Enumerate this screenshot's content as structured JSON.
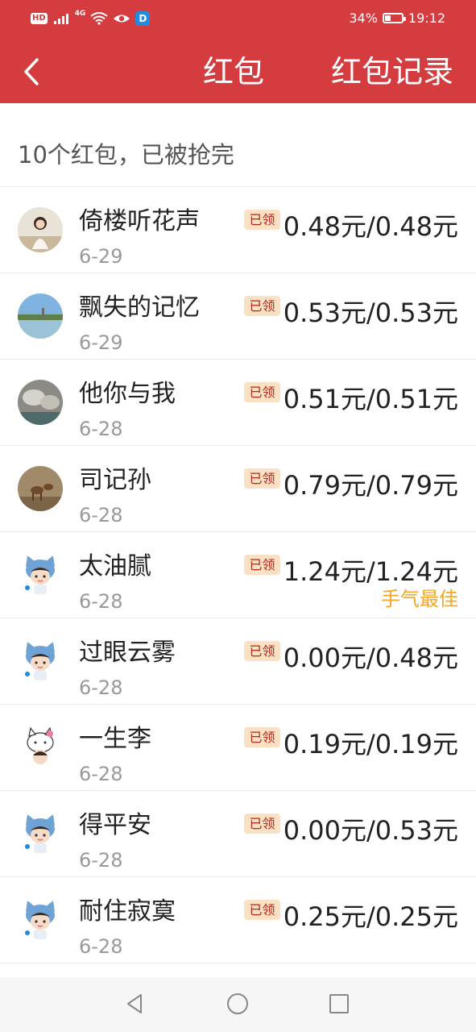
{
  "status_bar": {
    "hd": "HD",
    "network": "4G",
    "app_badge": "D",
    "battery_level": 0.34,
    "battery_percent": "34%",
    "time": "19:12"
  },
  "header": {
    "title": "红包",
    "records_label": "红包记录"
  },
  "summary": {
    "text": "10个红包，已被抢完"
  },
  "badge_label": "已领",
  "best_label": "手气最佳",
  "rows": [
    {
      "name": "倚楼听花声",
      "date": "6-29",
      "amount": "0.48元/0.48元",
      "avatar": "girl-photo"
    },
    {
      "name": "飘失的记忆",
      "date": "6-29",
      "amount": "0.53元/0.53元",
      "avatar": "lake-photo"
    },
    {
      "name": "他你与我",
      "date": "6-28",
      "amount": "0.51元/0.51元",
      "avatar": "rocks-photo"
    },
    {
      "name": "司记孙",
      "date": "6-28",
      "amount": "0.79元/0.79元",
      "avatar": "deer-photo"
    },
    {
      "name": "太油腻",
      "date": "6-28",
      "amount": "1.24元/1.24元",
      "avatar": "cartoon-wolf",
      "best": "手气最佳"
    },
    {
      "name": "过眼云雾",
      "date": "6-28",
      "amount": "0.00元/0.48元",
      "avatar": "cartoon-wolf"
    },
    {
      "name": "一生李",
      "date": "6-28",
      "amount": "0.19元/0.19元",
      "avatar": "cartoon-kitty"
    },
    {
      "name": "得平安",
      "date": "6-28",
      "amount": "0.00元/0.53元",
      "avatar": "cartoon-wolf"
    },
    {
      "name": "耐住寂寞",
      "date": "6-28",
      "amount": "0.25元/0.25元",
      "avatar": "cartoon-wolf"
    }
  ],
  "colors": {
    "brand_red": "#d43c40",
    "badge_bg": "#fbe1c4",
    "badge_text": "#b0271b",
    "best_gold": "#f5a623"
  }
}
